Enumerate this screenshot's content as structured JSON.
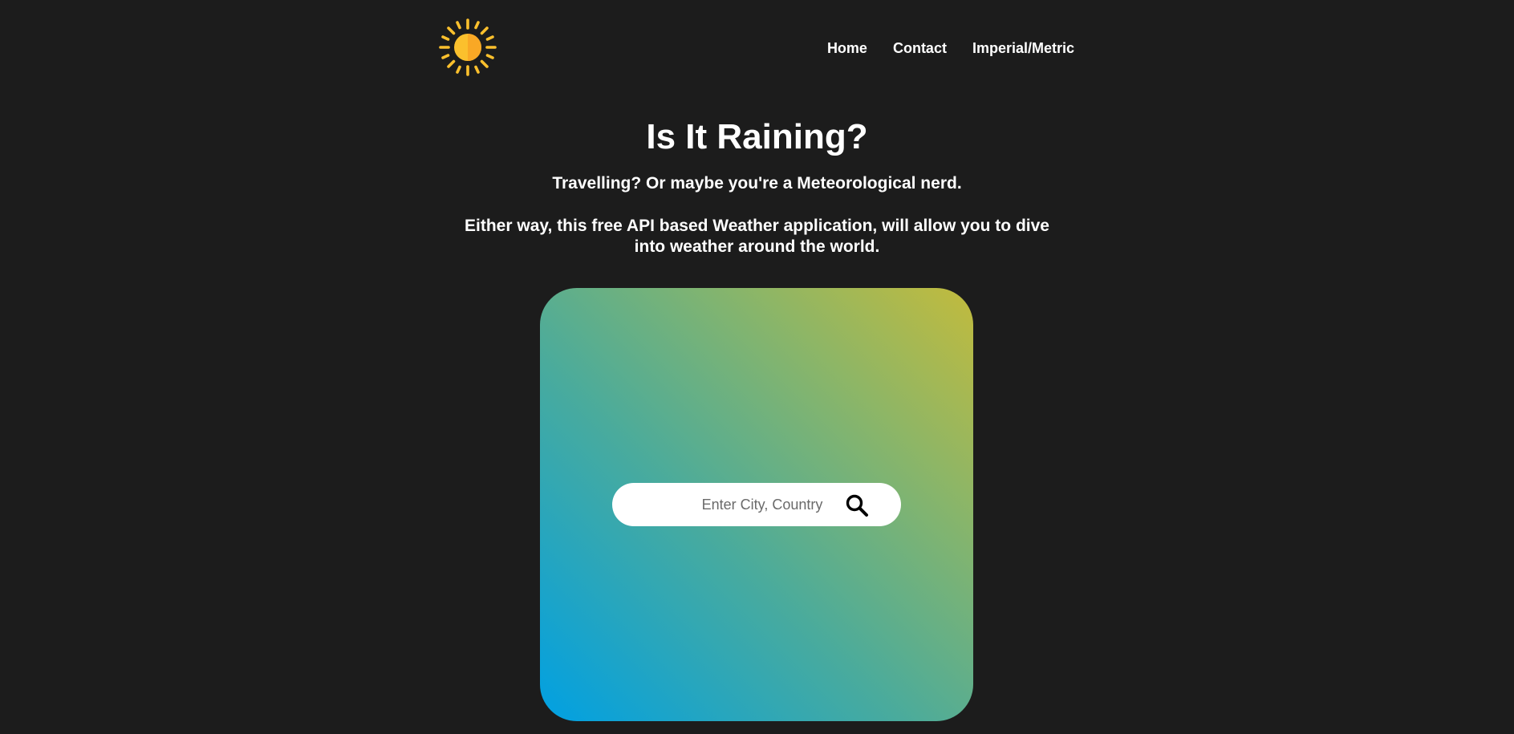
{
  "header": {
    "logo_icon": "sun-icon",
    "nav": [
      {
        "label": "Home"
      },
      {
        "label": "Contact"
      },
      {
        "label": "Imperial/Metric"
      }
    ]
  },
  "hero": {
    "title": "Is It Raining?",
    "subtitle": "Travelling? Or maybe you're a Meteorological nerd.",
    "description": "Either way, this free API based Weather application, will allow you to dive into weather around the world."
  },
  "search": {
    "placeholder": "Enter City, Country",
    "value": "",
    "icon": "search-icon"
  },
  "colors": {
    "background": "#1c1c1c",
    "sun": "#fbc02d",
    "gradient_start": "#00a0e3",
    "gradient_end": "#c2bb3d"
  }
}
